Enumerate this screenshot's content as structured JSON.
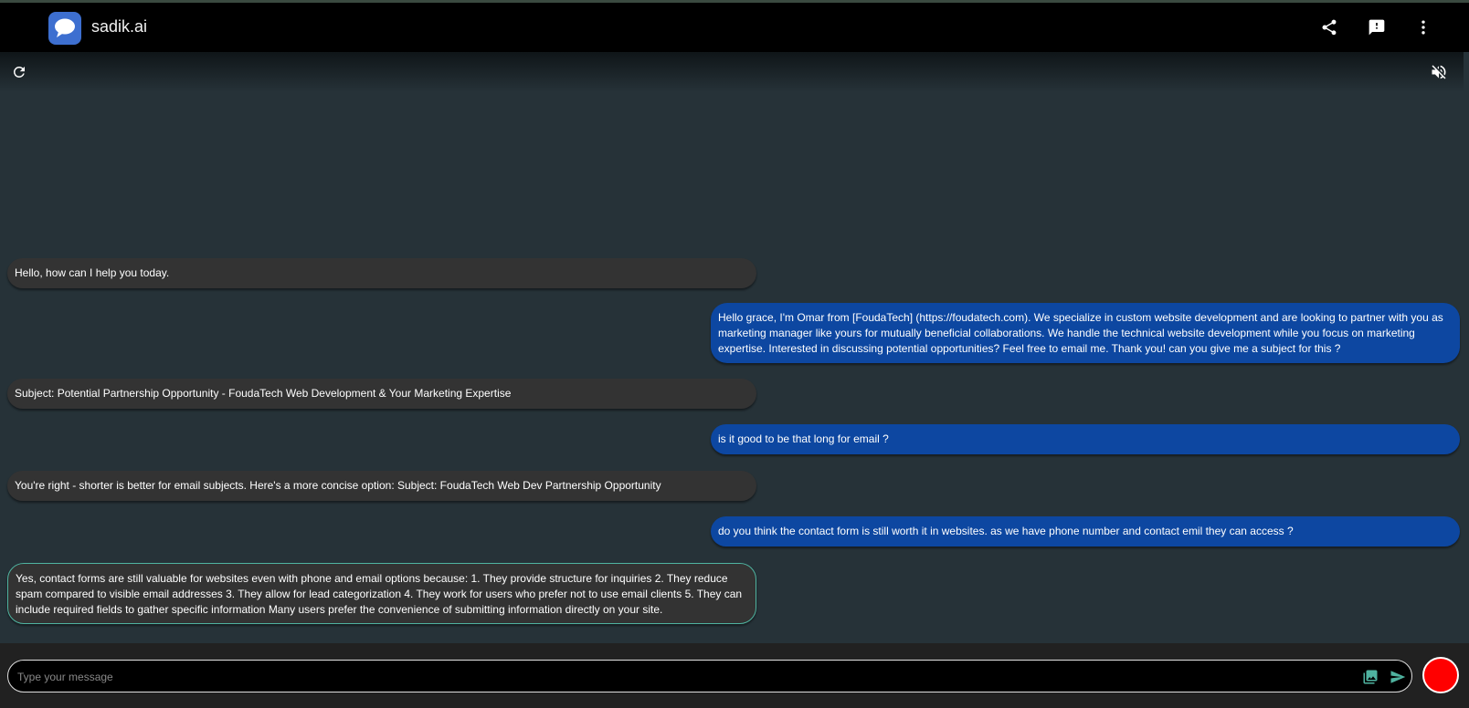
{
  "app": {
    "title": "sadik.ai",
    "logo_icon": "chat-bubble-icon"
  },
  "toolbar": {
    "share_icon": "share-icon",
    "feedback_icon": "feedback-icon",
    "menu_icon": "more-vert-icon",
    "refresh_icon": "refresh-icon",
    "mute_icon": "volume-off-icon"
  },
  "messages": [
    {
      "role": "bot",
      "text": "Hello, how can I help you today."
    },
    {
      "role": "user",
      "text": "Hello grace, I'm Omar from [FoudaTech] (https://foudatech.com). We specialize in custom website development and are looking to partner with you as marketing manager like yours for mutually beneficial collaborations. We handle the technical website development while you focus on marketing expertise. Interested in discussing potential opportunities? Feel free to email me. Thank you! can you give me a subject for this ?"
    },
    {
      "role": "bot",
      "text": "Subject: Potential Partnership Opportunity - FoudaTech Web Development & Your Marketing Expertise"
    },
    {
      "role": "user",
      "text": "is it good to be that long for email ?"
    },
    {
      "role": "bot",
      "text": "You're right - shorter is better for email subjects. Here's a more concise option: Subject: FoudaTech Web Dev Partnership Opportunity"
    },
    {
      "role": "user",
      "text": "do you think the contact form is still worth it in websites. as we have phone number and contact emil they can access ?"
    },
    {
      "role": "bot",
      "text": "Yes, contact forms are still valuable for websites even with phone and email options because: 1. They provide structure for inquiries 2. They reduce spam compared to visible email addresses 3. They allow for lead categorization 4. They work for users who prefer not to use email clients 5. They can include required fields to gather specific information Many users prefer the convenience of submitting information directly on your site."
    }
  ],
  "composer": {
    "placeholder": "Type your message",
    "value": "",
    "image_icon": "image-icon",
    "send_icon": "send-icon",
    "record_color": "#ff0000"
  },
  "colors": {
    "user_bubble": "#0d47a1",
    "bot_bubble": "#333333",
    "accent": "#4fb3a0"
  }
}
